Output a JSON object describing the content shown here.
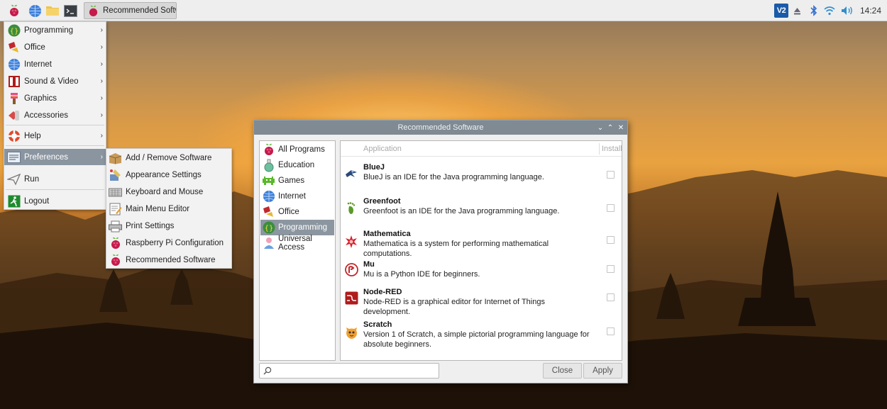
{
  "taskbar": {
    "task_label": "Recommended Softw...",
    "clock": "14:24",
    "vnc_label": "V2"
  },
  "main_menu": {
    "items": [
      {
        "label": "Programming",
        "icon": "programming-icon"
      },
      {
        "label": "Office",
        "icon": "office-icon"
      },
      {
        "label": "Internet",
        "icon": "internet-icon"
      },
      {
        "label": "Sound & Video",
        "icon": "sound-video-icon"
      },
      {
        "label": "Graphics",
        "icon": "graphics-icon"
      },
      {
        "label": "Accessories",
        "icon": "accessories-icon"
      },
      {
        "label": "Help",
        "icon": "help-icon"
      },
      {
        "label": "Preferences",
        "icon": "preferences-icon"
      },
      {
        "label": "Run",
        "icon": "run-icon"
      },
      {
        "label": "Logout",
        "icon": "logout-icon"
      }
    ]
  },
  "sub_menu": {
    "items": [
      {
        "label": "Add / Remove Software",
        "icon": "package-icon"
      },
      {
        "label": "Appearance Settings",
        "icon": "appearance-icon"
      },
      {
        "label": "Keyboard and Mouse",
        "icon": "keyboard-icon"
      },
      {
        "label": "Main Menu Editor",
        "icon": "menu-editor-icon"
      },
      {
        "label": "Print Settings",
        "icon": "printer-icon"
      },
      {
        "label": "Raspberry Pi Configuration",
        "icon": "raspberry-icon"
      },
      {
        "label": "Recommended Software",
        "icon": "raspberry-icon"
      }
    ]
  },
  "dialog": {
    "title": "Recommended Software",
    "categories": [
      {
        "label": "All Programs",
        "icon": "raspberry-icon"
      },
      {
        "label": "Education",
        "icon": "education-icon"
      },
      {
        "label": "Games",
        "icon": "games-icon"
      },
      {
        "label": "Internet",
        "icon": "internet-icon"
      },
      {
        "label": "Office",
        "icon": "office-icon"
      },
      {
        "label": "Programming",
        "icon": "programming-icon",
        "selected": true
      },
      {
        "label": "Universal Access",
        "icon": "universal-access-icon"
      }
    ],
    "columns": {
      "application": "Application",
      "install": "Install"
    },
    "apps": [
      {
        "name": "BlueJ",
        "description": "BlueJ is an IDE for the Java programming language.",
        "icon": "bluej-icon",
        "installed": false
      },
      {
        "name": "Greenfoot",
        "description": "Greenfoot is an IDE for the Java programming language.",
        "icon": "greenfoot-icon",
        "installed": false
      },
      {
        "name": "Mathematica",
        "description": "Mathematica is a system for performing mathematical computations.",
        "icon": "mathematica-icon",
        "installed": false
      },
      {
        "name": "Mu",
        "description": "Mu is a Python IDE for beginners.",
        "icon": "mu-icon",
        "installed": false
      },
      {
        "name": "Node-RED",
        "description": "Node-RED is a graphical editor for Internet of Things development.",
        "icon": "node-red-icon",
        "installed": false
      },
      {
        "name": "Scratch",
        "description": "Version 1 of Scratch, a simple pictorial programming language for absolute beginners.",
        "icon": "scratch-icon",
        "installed": false
      }
    ],
    "search_placeholder": "",
    "close_label": "Close",
    "apply_label": "Apply"
  },
  "colors": {
    "menu_highlight": "#8a95a0",
    "titlebar": "#7f8a93",
    "raspberry_red": "#c51a4a",
    "leaf_green": "#6cc04a"
  }
}
